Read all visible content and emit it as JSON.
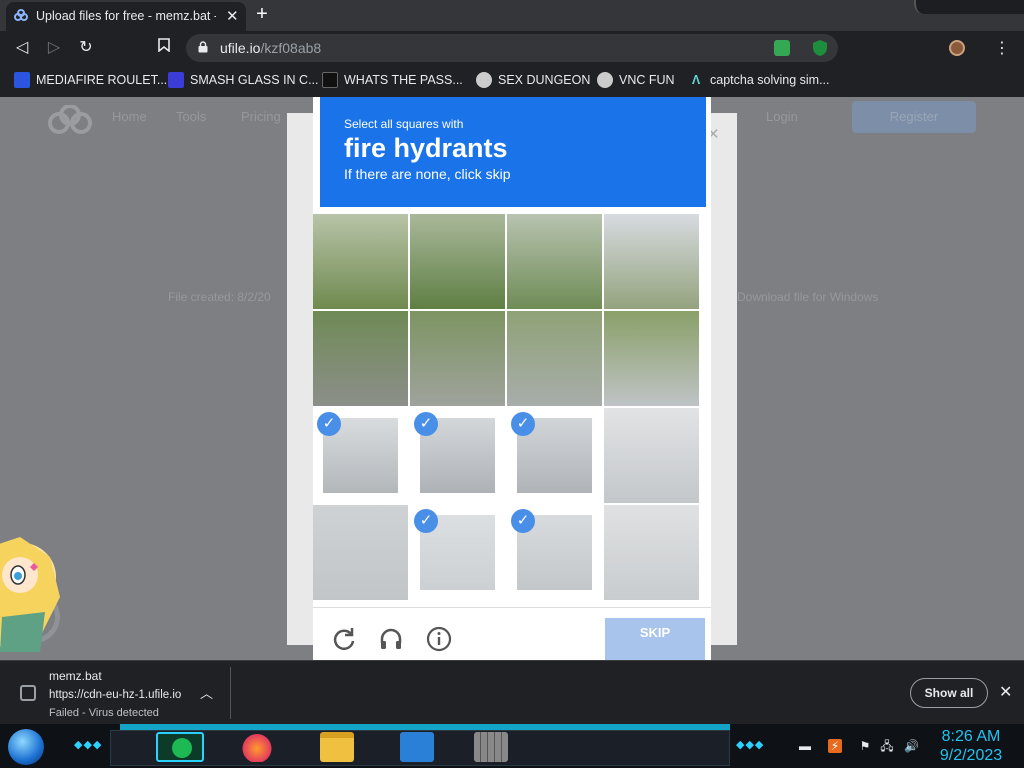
{
  "browser": {
    "tab_title": "Upload files for free - memz.bat - ufile.io",
    "tab_close": "✕",
    "new_tab": "+",
    "url_host": "ufile.io",
    "url_path": "/kzf08ab8",
    "menu_icon": "⋮"
  },
  "bookmarks": [
    {
      "label": "MEDIAFIRE ROULET...",
      "icon_color": "#2b55e0"
    },
    {
      "label": "SMASH GLASS IN C...",
      "icon_color": "#3b3bd6"
    },
    {
      "label": "WHATS THE PASS...",
      "icon_color": "#111111"
    },
    {
      "label": "SEX DUNGEON",
      "icon_color": "#dddddd"
    },
    {
      "label": "VNC FUN",
      "icon_color": "#dddddd"
    },
    {
      "label": "captcha solving sim...",
      "icon_color": "#5fd3d3"
    }
  ],
  "background_page": {
    "nav_items": [
      "Home",
      "Tools",
      "Pricing"
    ],
    "login": "Login",
    "register": "Register",
    "left_text": "File created: 8/2/20",
    "right_text": "Download file for Windows"
  },
  "captcha": {
    "instruction_line1": "Select all squares with",
    "target": "fire hydrants",
    "instruction_line3": "If there are none, click skip",
    "selected_tiles": [
      8,
      9,
      10,
      13,
      14
    ],
    "skip_label": "SKIP",
    "icons": [
      "reload-icon",
      "headphones-icon",
      "info-icon"
    ]
  },
  "download": {
    "filename": "memz.bat",
    "url": "https://cdn-eu-hz-1.ufile.io",
    "status": "Failed - Virus detected",
    "show_all": "Show all"
  },
  "taskbar": {
    "time": "8:26 AM",
    "date": "9/2/2023"
  }
}
